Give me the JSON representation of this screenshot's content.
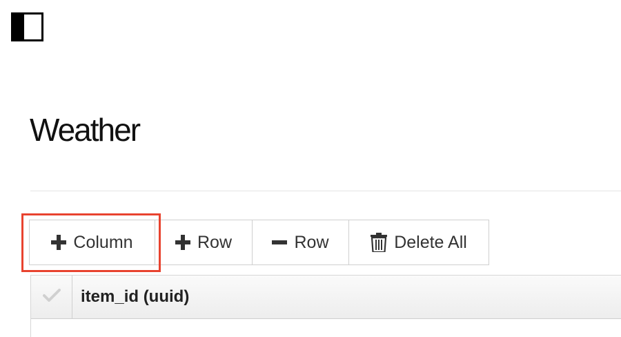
{
  "sidebar_toggle": {
    "icon": "sidebar-toggle-icon"
  },
  "page": {
    "title": "Weather"
  },
  "toolbar": {
    "add_column_label": "Column",
    "add_column_icon": "plus-icon",
    "add_row_label": "Row",
    "add_row_icon": "plus-icon",
    "remove_row_label": "Row",
    "remove_row_icon": "minus-icon",
    "delete_all_label": "Delete All",
    "delete_all_icon": "trash-icon"
  },
  "highlight": {
    "color": "#e8432f",
    "target": "add-column-button"
  },
  "table": {
    "select_all_icon": "checkmark-icon",
    "columns": [
      "item_id (uuid)"
    ]
  }
}
